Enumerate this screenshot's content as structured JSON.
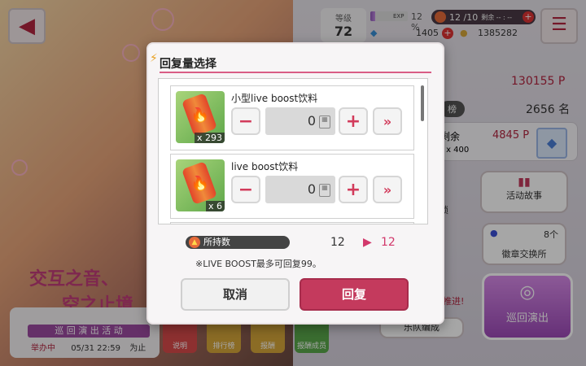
{
  "header": {
    "back_icon": "back-arrow-icon",
    "level_label": "等级",
    "level_value": "72",
    "exp_label": "EXP",
    "exp_percent": "12 %",
    "stamina_text": "12 /10",
    "stamina_extra": "剩余 -- : --",
    "stars": "1405",
    "coins": "1385282",
    "menu_icon": "hamburger-menu-icon"
  },
  "background": {
    "score_value": "130155",
    "score_unit": "P",
    "rank_label": "榜",
    "rank_value": "2656 名",
    "remain_label": "剩余",
    "remain_points": "4845",
    "remain_unit": "P",
    "remain_sub": ") x 400",
    "event_story": "活动故事",
    "lock_text": "锁",
    "badge_count": "8个",
    "badge_exchange": "徽章交换所",
    "tour_button": "巡回演出",
    "band_edit": "乐队编成",
    "promote_text": "推进!",
    "event_title_line1": "交互之音、",
    "event_title_line2": "空之止境",
    "event_tag": "巡 回 演 出 活 动",
    "event_status": "举办中",
    "event_date": "05/31 22:59",
    "event_until": "为止",
    "tiles": [
      {
        "label": "说明",
        "color": "#d94a4a"
      },
      {
        "label": "排行榜",
        "color": "#d6a63a"
      },
      {
        "label": "报酬",
        "color": "#d6a63a"
      },
      {
        "label": "报酬成员",
        "color": "#5aa84a"
      }
    ]
  },
  "modal": {
    "title": "回复量选择",
    "items": [
      {
        "name": "小型live boost饮料",
        "count": "x 293",
        "qty": "0"
      },
      {
        "name": "live boost饮料",
        "count": "x 6",
        "qty": "0"
      }
    ],
    "hold_label": "所持数",
    "hold_from": "12",
    "hold_to": "12",
    "note": "※LIVE BOOST最多可回复99。",
    "cancel_label": "取消",
    "confirm_label": "回复"
  },
  "colors": {
    "accent": "#c43a5d",
    "title_line": "#d95d85",
    "purple": "#9c4aa0"
  }
}
